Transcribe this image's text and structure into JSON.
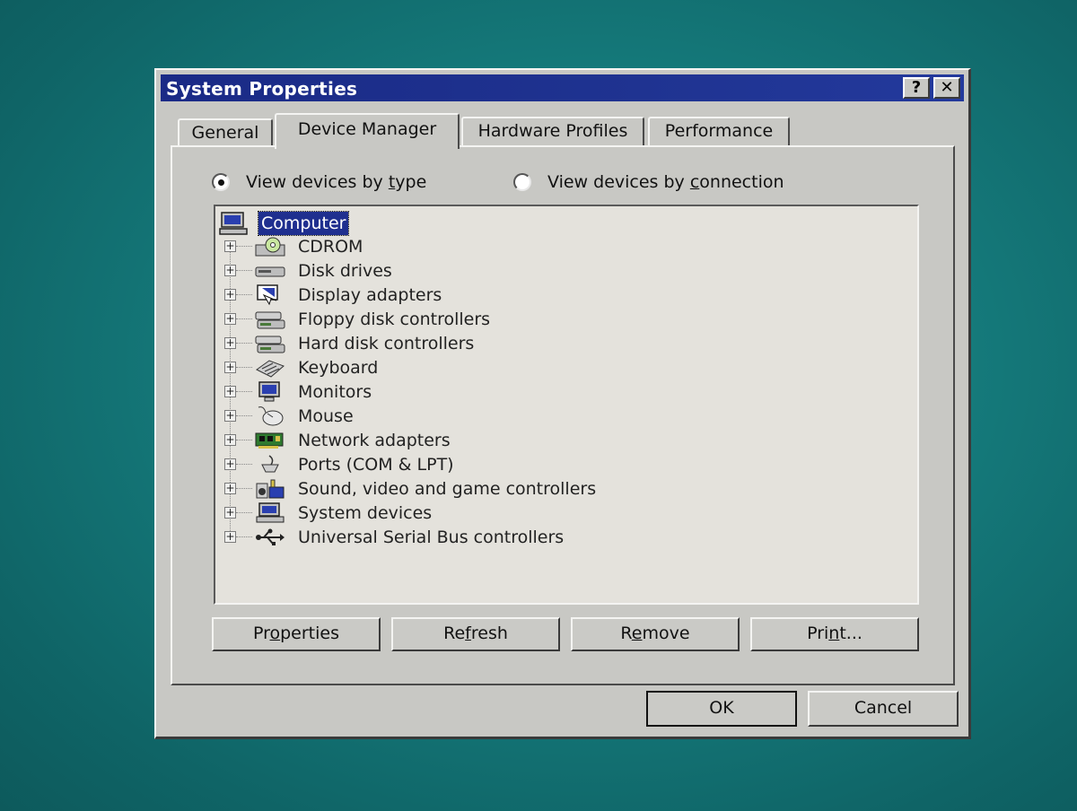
{
  "window": {
    "title": "System Properties",
    "help_glyph": "?",
    "close_glyph": "✕"
  },
  "tabs": [
    {
      "label": "General",
      "selected": false
    },
    {
      "label": "Device Manager",
      "selected": true
    },
    {
      "label": "Hardware Profiles",
      "selected": false
    },
    {
      "label": "Performance",
      "selected": false
    }
  ],
  "view_mode": {
    "by_type": {
      "pre": "View devices by ",
      "key": "t",
      "post": "ype",
      "checked": true
    },
    "by_connection": {
      "pre": "View devices by ",
      "key": "c",
      "post": "onnection",
      "checked": false
    }
  },
  "tree": {
    "root": {
      "label": "Computer",
      "icon": "computer-icon"
    },
    "items": [
      {
        "label": "CDROM",
        "icon": "cdrom-icon"
      },
      {
        "label": "Disk drives",
        "icon": "disk-drive-icon"
      },
      {
        "label": "Display adapters",
        "icon": "display-adapter-icon"
      },
      {
        "label": "Floppy disk controllers",
        "icon": "floppy-controller-icon"
      },
      {
        "label": "Hard disk controllers",
        "icon": "hard-disk-controller-icon"
      },
      {
        "label": "Keyboard",
        "icon": "keyboard-icon"
      },
      {
        "label": "Monitors",
        "icon": "monitor-icon"
      },
      {
        "label": "Mouse",
        "icon": "mouse-icon"
      },
      {
        "label": "Network adapters",
        "icon": "network-adapter-icon"
      },
      {
        "label": "Ports (COM & LPT)",
        "icon": "port-icon"
      },
      {
        "label": "Sound, video and game controllers",
        "icon": "sound-icon"
      },
      {
        "label": "System devices",
        "icon": "system-device-icon"
      },
      {
        "label": "Universal Serial Bus controllers",
        "icon": "usb-icon"
      }
    ],
    "expander_glyph": "+"
  },
  "buttons": {
    "properties": {
      "pre": "Pr",
      "key": "o",
      "post": "perties"
    },
    "refresh": {
      "pre": "Re",
      "key": "f",
      "post": "resh"
    },
    "remove": {
      "pre": "R",
      "key": "e",
      "post": "move"
    },
    "print": {
      "pre": "Pri",
      "key": "n",
      "post": "t..."
    },
    "ok": "OK",
    "cancel": "Cancel"
  },
  "colors": {
    "desktop": "#157a7b",
    "titlebar": "#1f3391",
    "selection": "#1f2f8f",
    "face": "#c8c8c4"
  }
}
